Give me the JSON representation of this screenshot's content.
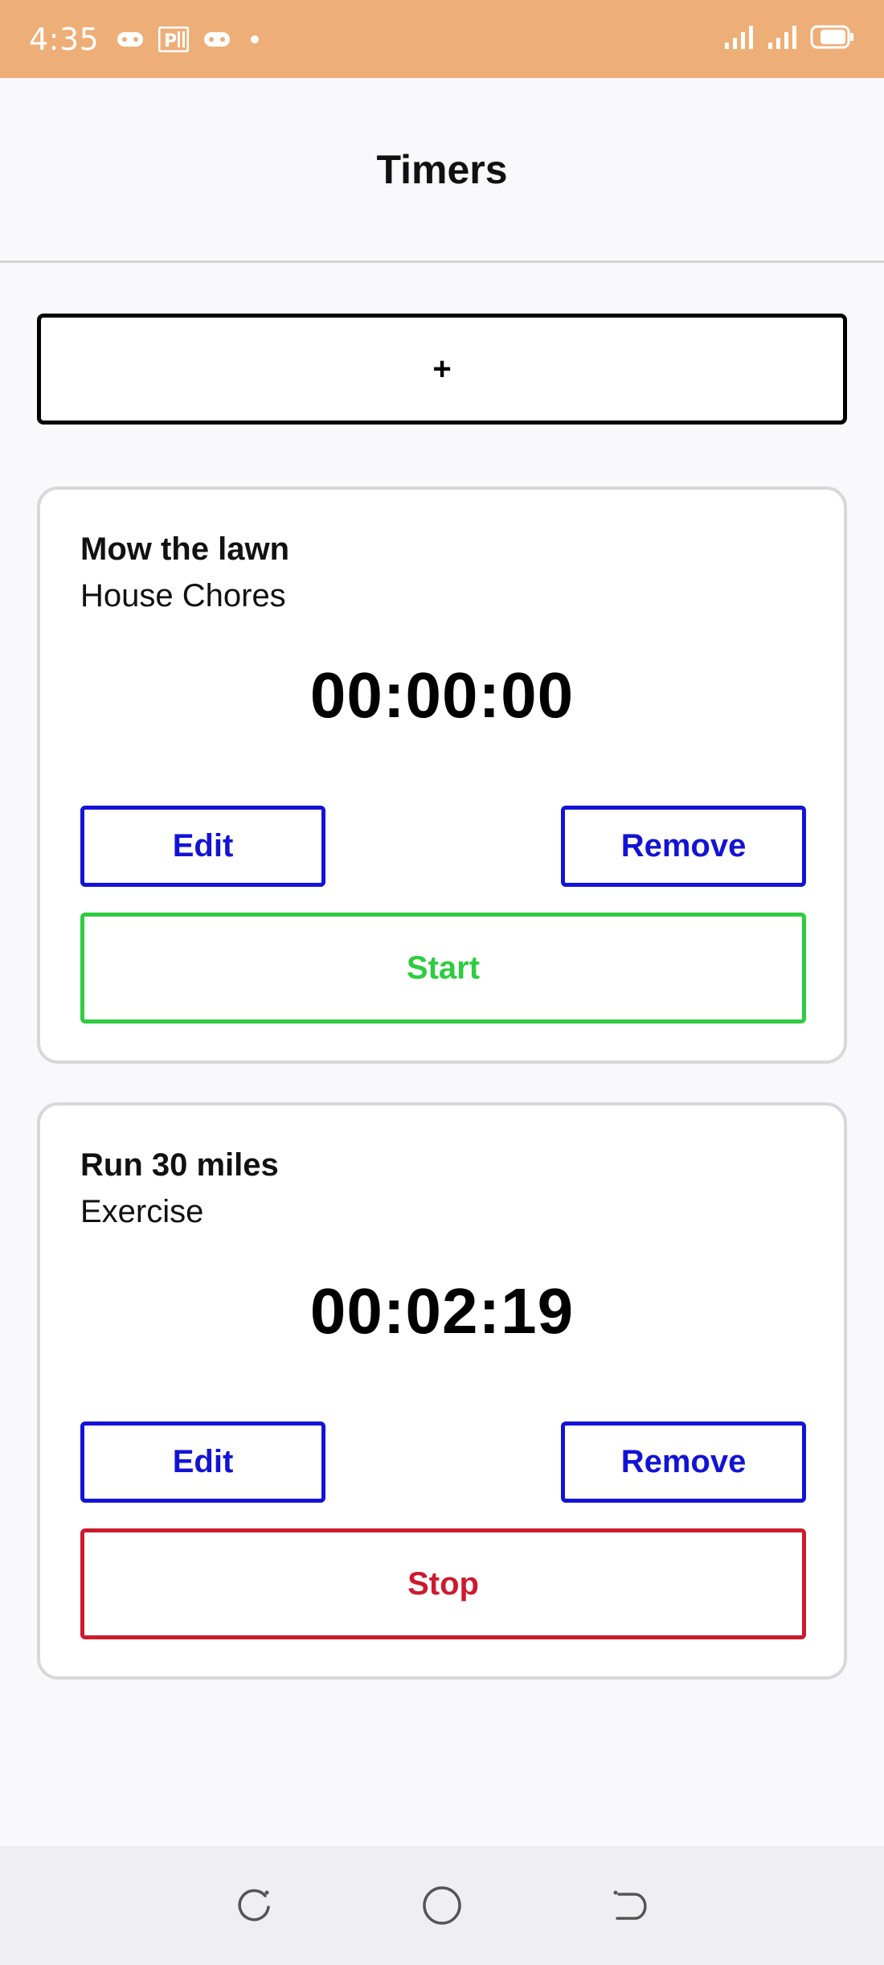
{
  "status_bar": {
    "time": "4:35",
    "icons": [
      "gamepad-icon",
      "parking-app-icon",
      "gamepad-icon",
      "dot-icon",
      "signal-icon",
      "signal-icon",
      "battery-icon"
    ]
  },
  "header": {
    "title": "Timers"
  },
  "add_button": {
    "label": "+"
  },
  "timers": [
    {
      "name": "Mow the lawn",
      "category": "House Chores",
      "elapsed": "00:00:00",
      "edit_label": "Edit",
      "remove_label": "Remove",
      "action_label": "Start",
      "state": "stopped"
    },
    {
      "name": "Run 30 miles",
      "category": "Exercise",
      "elapsed": "00:02:19",
      "edit_label": "Edit",
      "remove_label": "Remove",
      "action_label": "Stop",
      "state": "running"
    }
  ],
  "nav_bar": {
    "items": [
      "recents-icon",
      "home-icon",
      "back-icon"
    ]
  },
  "colors": {
    "status_bar": "#eeae78",
    "edit_remove": "#1313d6",
    "start": "#2ecc40",
    "stop": "#cc1a2e"
  }
}
